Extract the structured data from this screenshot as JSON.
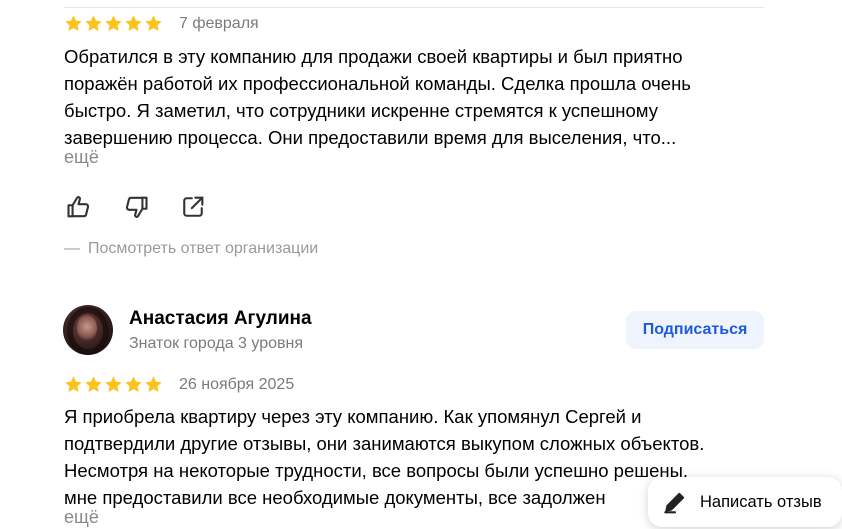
{
  "colors": {
    "star": "#fcc31e",
    "subscribe_bg": "#eef3fc",
    "subscribe_text": "#1f5bd6",
    "muted": "#8a8a8a"
  },
  "review1": {
    "rating": 5,
    "date": "7 февраля",
    "text_lines": [
      "Обратился в эту компанию для продажи своей квартиры и был приятно",
      "поражён работой их профессиональной команды. Сделка прошла очень",
      "быстро. Я заметил, что сотрудники искренне стремятся к успешному",
      "завершению процесса. Они предоставили время для выселения, что..."
    ],
    "more_label": "ещё",
    "actions": {
      "like_icon": "thumbs-up-icon",
      "dislike_icon": "thumbs-down-icon",
      "share_icon": "share-icon"
    },
    "org_reply_dash": "—",
    "org_reply_label": "Посмотреть ответ организации"
  },
  "review2": {
    "author": {
      "name": "Анастасия Агулина",
      "level": "Знаток города 3 уровня"
    },
    "subscribe_label": "Подписаться",
    "rating": 5,
    "date": "26 ноября 2025",
    "text_lines": [
      "Я приобрела квартиру через эту компанию. Как упомянул Сергей и",
      "подтвердили другие отзывы, они занимаются выкупом сложных объектов.",
      "Несмотря на некоторые трудности, все вопросы были успешно решены,",
      "мне предоставили все необходимые документы, все задолжен"
    ],
    "more_label": "ещё"
  },
  "write_review": {
    "icon": "pencil-icon",
    "label": "Написать отзыв"
  }
}
